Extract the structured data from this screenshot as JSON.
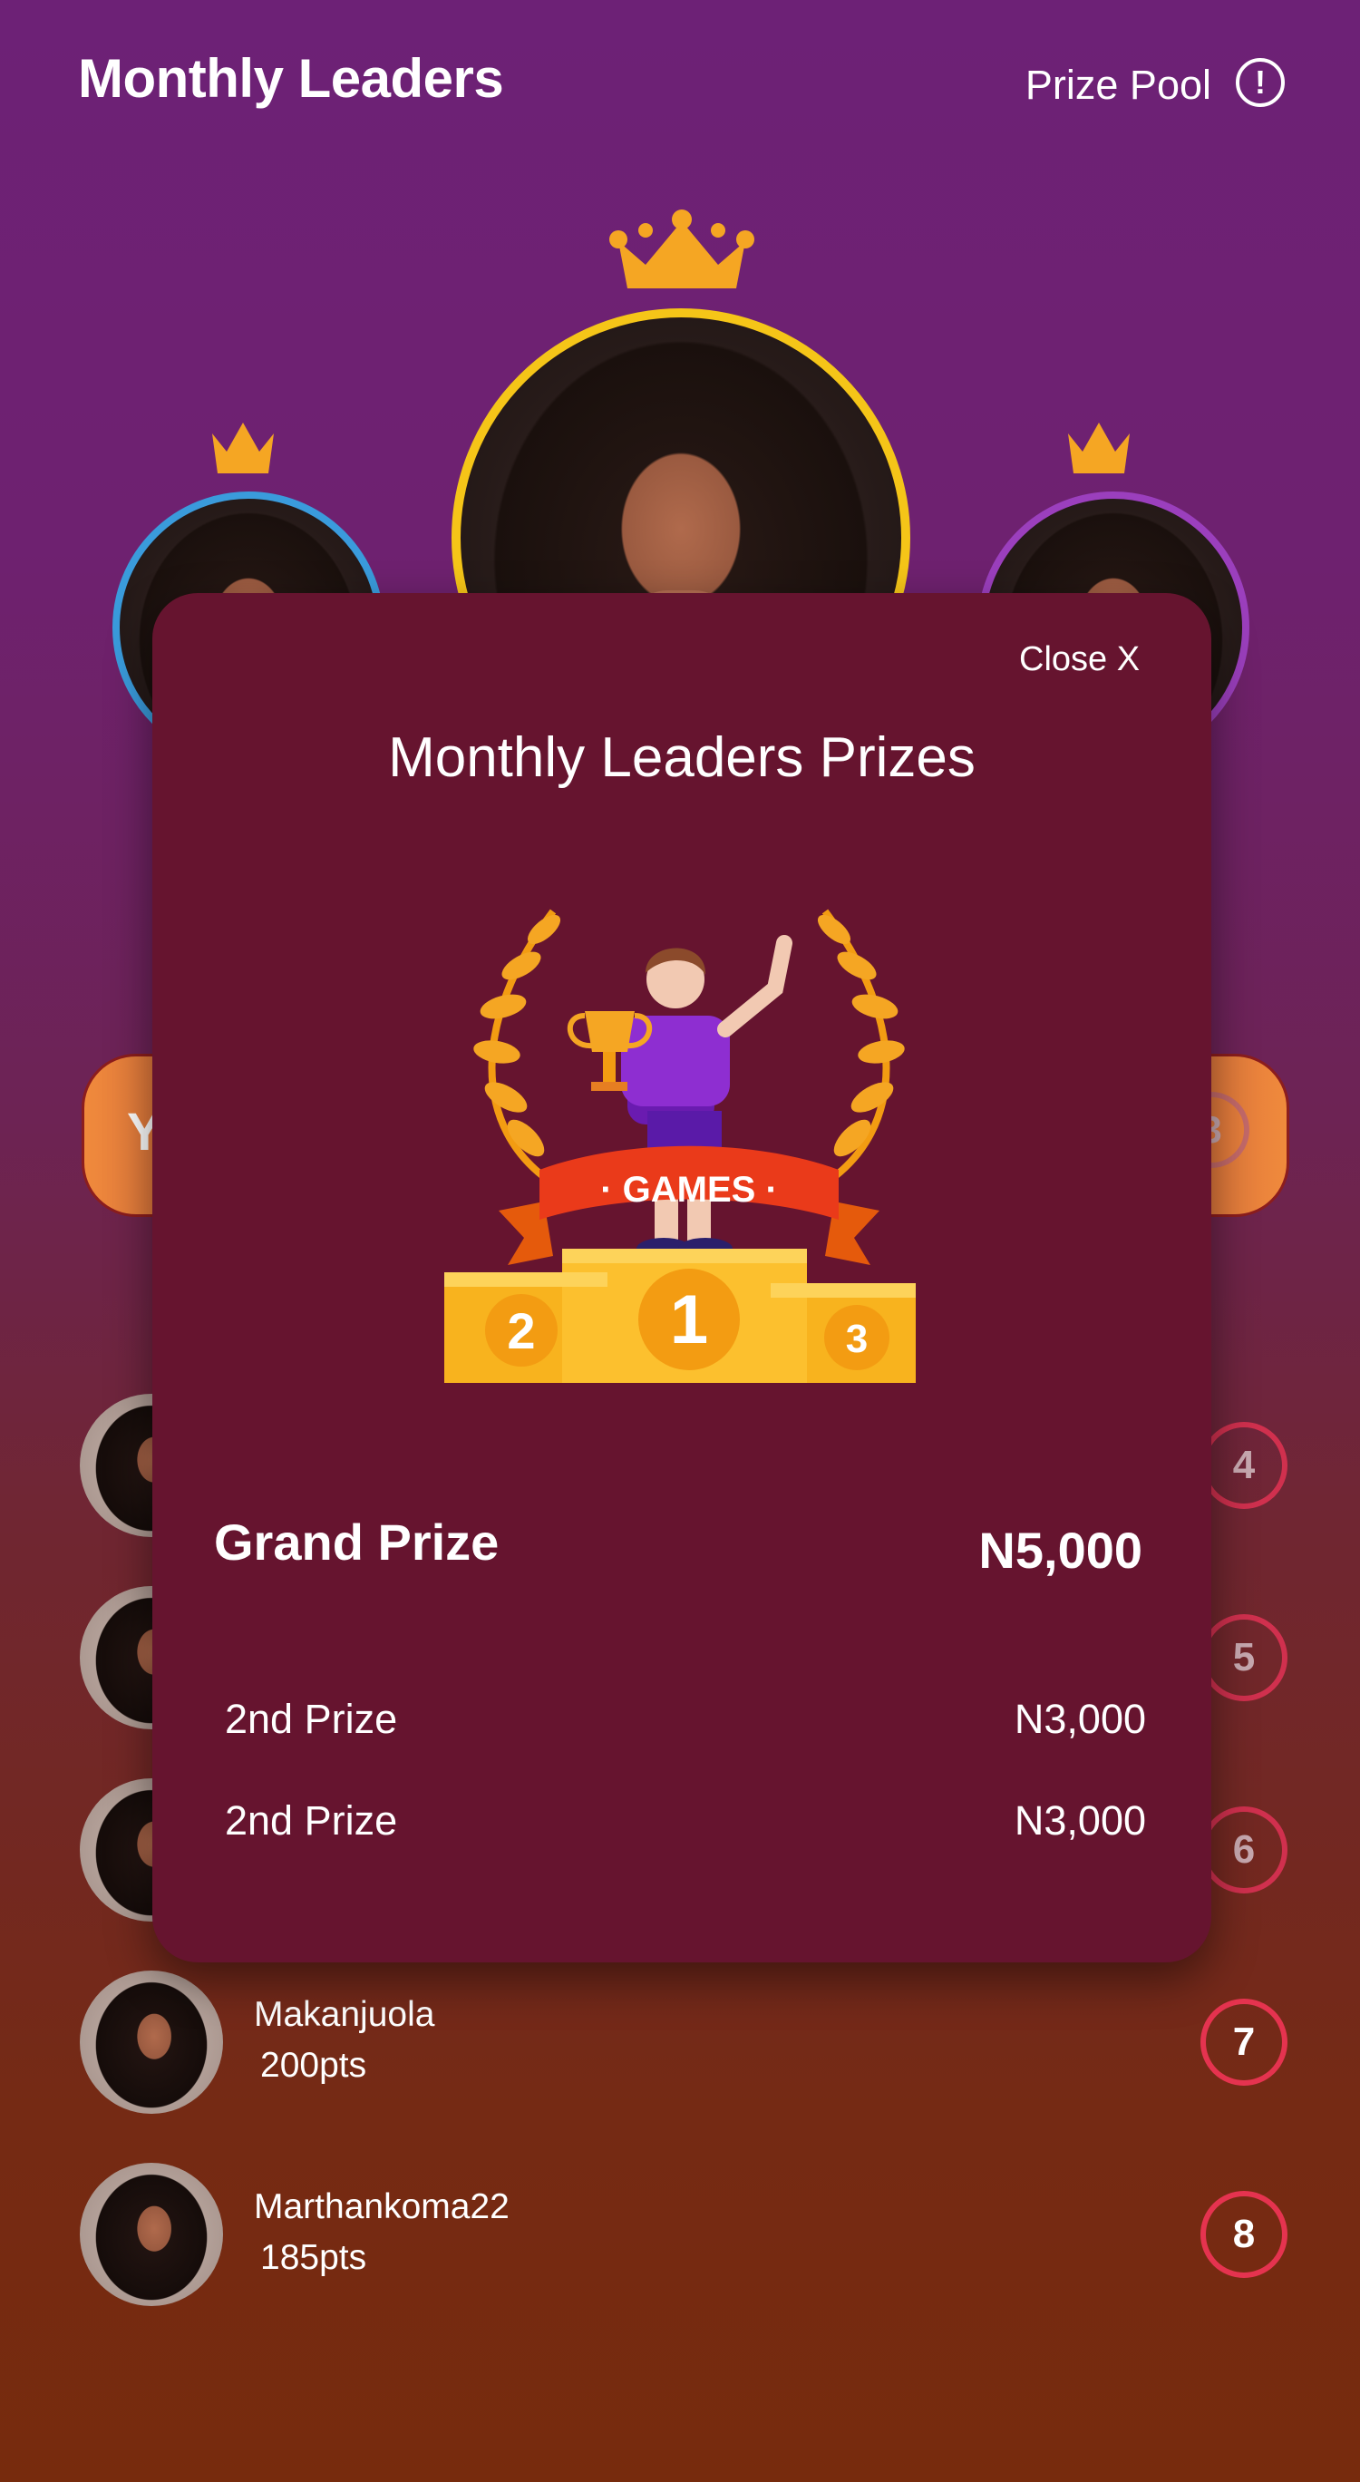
{
  "header": {
    "title": "Monthly Leaders",
    "prize_pool_label": "Prize Pool",
    "info_icon": "!"
  },
  "podium": [
    {
      "position": 2,
      "ring_color": "#3a9bdc"
    },
    {
      "position": 1,
      "ring_color": "#f5c518"
    },
    {
      "position": 3,
      "ring_color": "#9b3fbd"
    }
  ],
  "your_rank": {
    "label": "Y",
    "rank": "3"
  },
  "leaderboard": [
    {
      "rank": "4"
    },
    {
      "rank": "5"
    },
    {
      "rank": "6"
    },
    {
      "rank": "7",
      "name": "Makanjuola",
      "points": "200pts"
    },
    {
      "rank": "8",
      "name": "Marthankoma22",
      "points": "185pts"
    }
  ],
  "modal": {
    "close_label": "Close X",
    "title": "Monthly Leaders Prizes",
    "illustration": {
      "banner_text": "· GAMES ·",
      "podium_labels": [
        "2",
        "1",
        "3"
      ]
    },
    "grand_prize": {
      "label": "Grand Prize",
      "value": "N5,000"
    },
    "prizes": [
      {
        "label": "2nd Prize",
        "value": "N3,000"
      },
      {
        "label": "2nd Prize",
        "value": "N3,000"
      }
    ]
  },
  "colors": {
    "accent": "#e5334f",
    "modal_bg": "#66142f",
    "crown": "#f5a623"
  }
}
